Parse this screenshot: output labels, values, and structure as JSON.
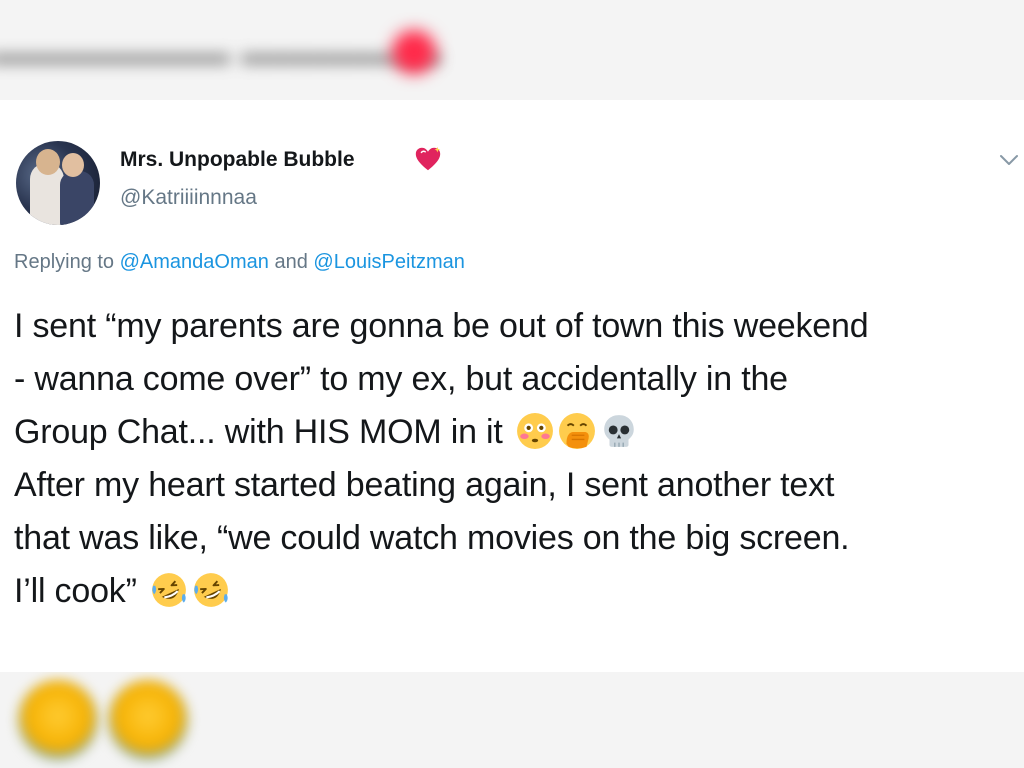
{
  "tweet": {
    "display_name": "Mrs. Unpopable Bubble",
    "handle": "@Katriiiinnnaa",
    "replying_prefix": "Replying to",
    "mention_1": "@AmandaOman",
    "replying_and": "and",
    "mention_2": "@LouisPeitzman",
    "lines": [
      "I sent “my parents are gonna be out of town this weekend",
      "- wanna come over” to my ex, but accidentally in the",
      "Group Chat... with HIS MOM in it",
      "After my heart started beating again, I sent another text",
      "that was like, “we could watch movies on the big screen.",
      "I’ll cook”"
    ],
    "icons": {
      "name_badge": "sparkling-heart-icon",
      "menu": "chevron-down-icon",
      "line3_emojis": [
        "flushed-face-icon",
        "face-with-hand-over-mouth-icon",
        "skull-icon"
      ],
      "line6_emojis": [
        "rolling-on-floor-laughing-icon",
        "rolling-on-floor-laughing-icon"
      ]
    }
  },
  "colors": {
    "name_text": "#14171a",
    "secondary_text": "#657786",
    "link": "#1b95e0",
    "heart": "#e0245e"
  }
}
